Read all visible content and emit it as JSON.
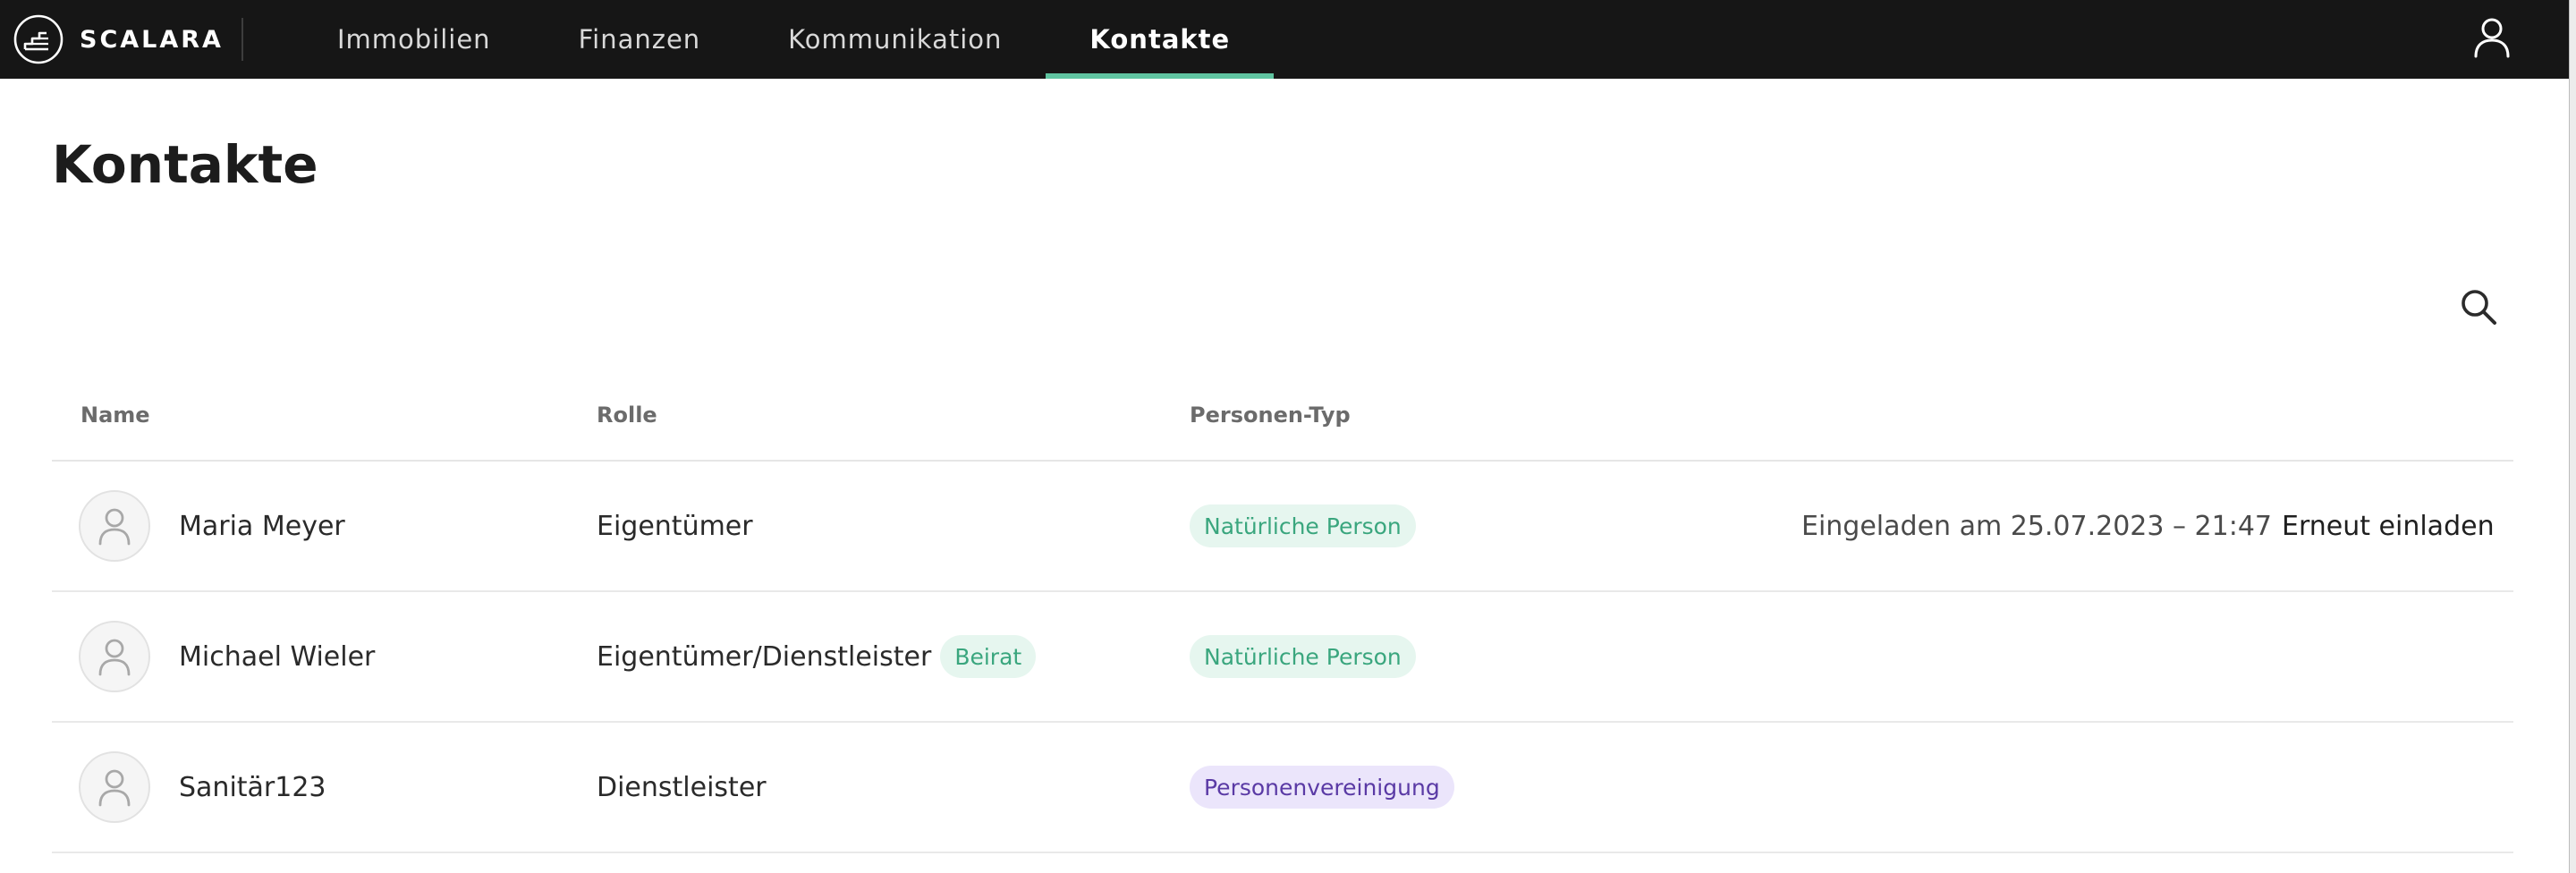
{
  "app": {
    "brand": "SCALARA"
  },
  "nav": {
    "items": [
      {
        "label": "Immobilien"
      },
      {
        "label": "Finanzen"
      },
      {
        "label": "Kommunikation"
      },
      {
        "label": "Kontakte"
      }
    ],
    "active": "Kontakte"
  },
  "page": {
    "title": "Kontakte"
  },
  "table": {
    "columns": [
      "Name",
      "Rolle",
      "Personen-Typ"
    ],
    "rows": [
      {
        "name": "Maria Meyer",
        "role": "Eigentümer",
        "role_badge": "",
        "person_type": "Natürliche Person",
        "invite_status": "Eingeladen am 25.07.2023 – 21:47",
        "action": "Erneut einladen"
      },
      {
        "name": "Michael Wieler",
        "role": "Eigentümer/Dienstleister",
        "role_badge": "Beirat",
        "person_type": "Natürliche Person",
        "invite_status": "",
        "action": ""
      },
      {
        "name": "Sanitär123",
        "role": "Dienstleister",
        "role_badge": "",
        "person_type": "Personenvereinigung",
        "invite_status": "",
        "action": ""
      }
    ]
  },
  "icons": {
    "logo": "scalara-logo-icon",
    "user": "user-icon",
    "search": "search-icon",
    "avatar": "person-avatar-icon"
  },
  "colors": {
    "topbar": "#161616",
    "active_underline": "#5fc4a0",
    "badge_green_bg": "#e6f6ef",
    "badge_green_text": "#3aa67e",
    "badge_purple_bg": "#ebe5fb",
    "badge_purple_text": "#5a3aa5"
  }
}
